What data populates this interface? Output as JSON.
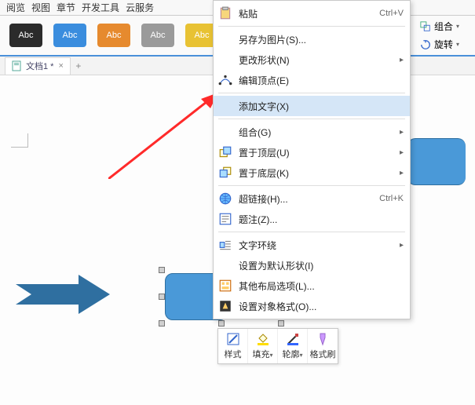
{
  "menubar": [
    "阅览",
    "视图",
    "章节",
    "开发工具",
    "云服务"
  ],
  "swatch_label": "Abc",
  "right_toolbar": {
    "group": "组合",
    "rotate": "旋转"
  },
  "tab": {
    "title": "文档1 *",
    "close": "×",
    "add": "+"
  },
  "context_menu": {
    "paste": "粘贴",
    "paste_key": "Ctrl+V",
    "save_as_pic": "另存为图片(S)...",
    "change_shape": "更改形状(N)",
    "edit_points": "编辑顶点(E)",
    "add_text": "添加文字(X)",
    "group": "组合(G)",
    "bring_front": "置于顶层(U)",
    "send_back": "置于底层(K)",
    "hyperlink": "超链接(H)...",
    "hyperlink_key": "Ctrl+K",
    "caption": "题注(Z)...",
    "wrap": "文字环绕",
    "set_default": "设置为默认形状(I)",
    "more_layout": "其他布局选项(L)...",
    "format_object": "设置对象格式(O)..."
  },
  "float_toolbar": {
    "style": "样式",
    "fill": "填充",
    "outline": "轮廓",
    "format_painter": "格式刷"
  },
  "colors": {
    "accent": "#4a99d8",
    "arrow_red": "#ff2a2a",
    "arrow_blue": "#2f6fa0"
  }
}
